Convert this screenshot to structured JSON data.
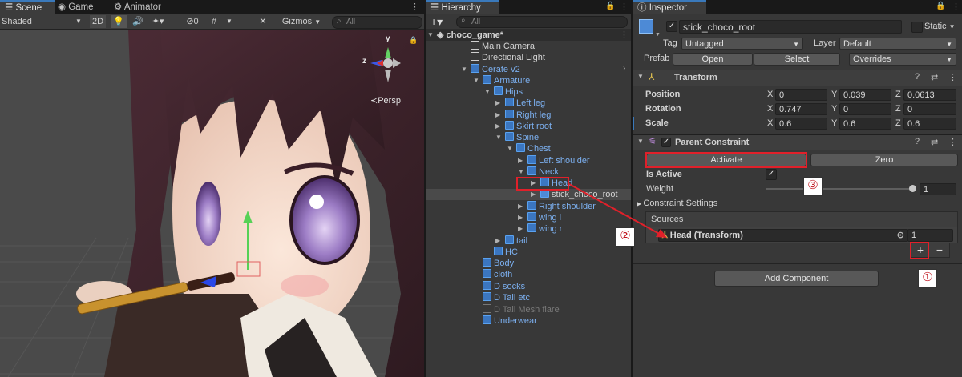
{
  "scene": {
    "tabs": [
      "Scene",
      "Game",
      "Animator"
    ],
    "shading": "Shaded",
    "mode2d": "2D",
    "hidden_count": "0",
    "gizmos": "Gizmos",
    "search_placeholder": "All",
    "persp_label": "Persp",
    "axis_y": "y",
    "axis_z": "z"
  },
  "hierarchy": {
    "title": "Hierarchy",
    "search_placeholder": "All",
    "items": [
      {
        "label": "choco_game*"
      },
      {
        "label": "Main Camera"
      },
      {
        "label": "Directional Light"
      },
      {
        "label": "Cerate v2"
      },
      {
        "label": "Armature"
      },
      {
        "label": "Hips"
      },
      {
        "label": "Left leg"
      },
      {
        "label": "Right leg"
      },
      {
        "label": "Skirt root"
      },
      {
        "label": "Spine"
      },
      {
        "label": "Chest"
      },
      {
        "label": "Left shoulder"
      },
      {
        "label": "Neck"
      },
      {
        "label": "Head"
      },
      {
        "label": "stick_choco_root"
      },
      {
        "label": "Right shoulder"
      },
      {
        "label": "wing l"
      },
      {
        "label": "wing r"
      },
      {
        "label": "tail"
      },
      {
        "label": "HC"
      },
      {
        "label": "Body"
      },
      {
        "label": "cloth"
      },
      {
        "label": "D socks"
      },
      {
        "label": "D Tail etc"
      },
      {
        "label": "D Tail Mesh flare"
      },
      {
        "label": "Underwear"
      }
    ]
  },
  "inspector": {
    "title": "Inspector",
    "object_name": "stick_choco_root",
    "static_label": "Static",
    "tag_label": "Tag",
    "tag_value": "Untagged",
    "layer_label": "Layer",
    "layer_value": "Default",
    "prefab_label": "Prefab",
    "open_button": "Open",
    "select_button": "Select",
    "overrides": "Overrides",
    "transform": {
      "title": "Transform",
      "position_label": "Position",
      "rotation_label": "Rotation",
      "scale_label": "Scale",
      "position": {
        "x": "0",
        "y": "0.039",
        "z": "0.0613"
      },
      "rotation": {
        "x": "0.747",
        "y": "0",
        "z": "0"
      },
      "scale": {
        "x": "0.6",
        "y": "0.6",
        "z": "0.6"
      },
      "x": "X",
      "y": "Y",
      "z": "Z"
    },
    "parent_constraint": {
      "title": "Parent Constraint",
      "activate_button": "Activate",
      "zero_button": "Zero",
      "is_active_label": "Is Active",
      "weight_label": "Weight",
      "weight_value": "1",
      "weight_fraction": 1.0,
      "constraint_settings": "Constraint Settings",
      "sources_label": "Sources",
      "source_name": "Head (Transform)",
      "source_weight": "1",
      "add_button": "+",
      "remove_button": "−"
    },
    "add_component": "Add Component"
  },
  "annotations": {
    "one": "①",
    "two": "②",
    "three": "③",
    "color": "#e0202a"
  }
}
